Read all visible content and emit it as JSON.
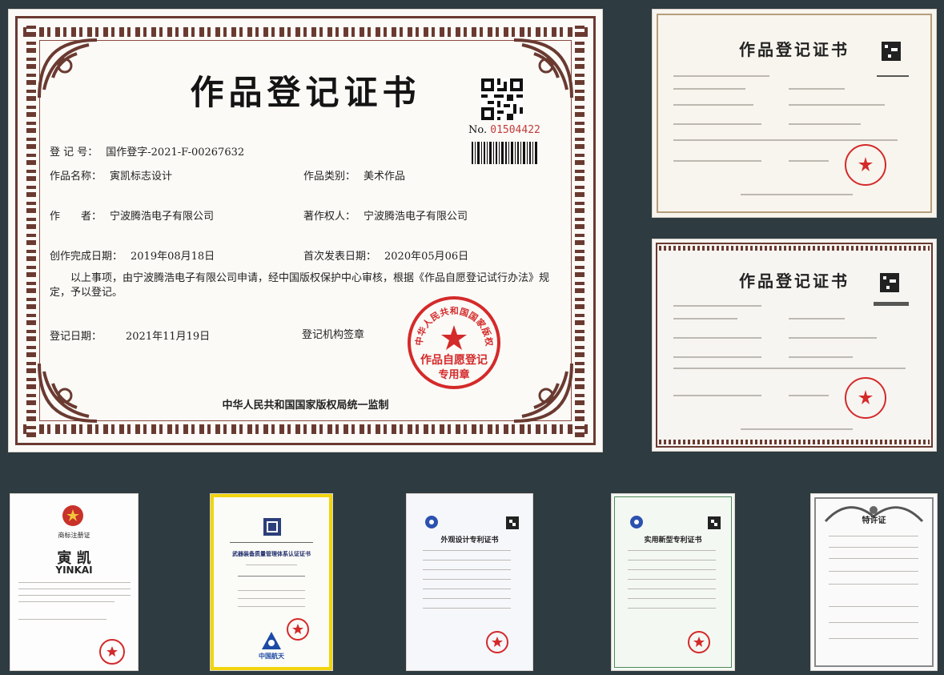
{
  "main_certificate": {
    "title": "作品登记证书",
    "number_label": "No.",
    "number_value": "01504422",
    "reg_no_label": "登 记 号：",
    "reg_no_value": "国作登字-2021-F-00267632",
    "work_name_label": "作品名称：",
    "work_name_value": "寅凯标志设计",
    "work_type_label": "作品类别：",
    "work_type_value": "美术作品",
    "author_label": "作　　者：",
    "author_value": "宁波腾浩电子有限公司",
    "copyright_owner_label": "著作权人：",
    "copyright_owner_value": "宁波腾浩电子有限公司",
    "completion_date_label": "创作完成日期：",
    "completion_date_value": "2019年08月18日",
    "publish_date_label": "首次发表日期：",
    "publish_date_value": "2020年05月06日",
    "statement": "以上事项，由宁波腾浩电子有限公司申请，经中国版权保护中心审核，根据《作品自愿登记试行办法》规定，予以登记。",
    "reg_date_label": "登记日期：",
    "reg_date_value": "2021年11月19日",
    "seal_label": "登记机构签章",
    "seal_outer_text": "中华人民共和国国家版权局",
    "seal_inner_line1": "作品自愿登记",
    "seal_inner_line2": "专用章",
    "footer": "中华人民共和国国家版权局统一监制"
  },
  "thumbnails": {
    "cert_a_title": "作品登记证书",
    "cert_b_title": "作品登记证书",
    "trademark_brand_cn": "寅 凯",
    "trademark_brand_en": "YINKAI",
    "trademark_title": "商标注册证",
    "quality_title": "武器装备质量管理体系认证证书",
    "quality_brand": "中国航天",
    "design_patent_title": "外观设计专利证书",
    "utility_patent_title": "实用新型专利证书",
    "invention_title": "特许证"
  },
  "colors": {
    "background": "#2e3b40",
    "border_brown": "#6a3a31",
    "seal_red": "#d42a2a",
    "number_red": "#c23b3b",
    "frame_yellow": "#f1d40d"
  }
}
